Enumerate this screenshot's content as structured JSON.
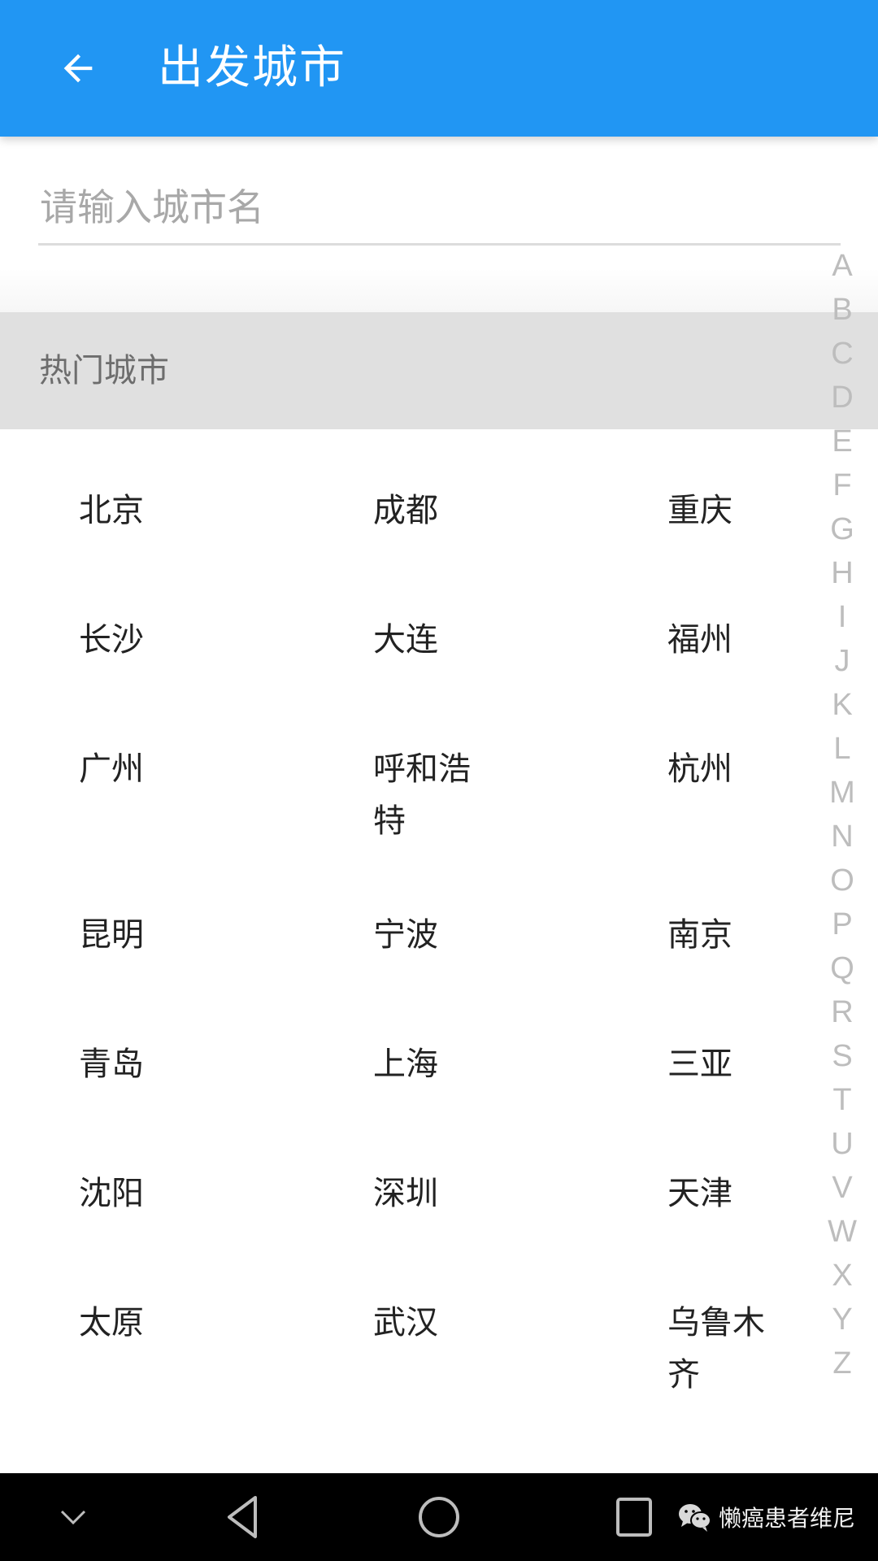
{
  "appbar": {
    "title": "出发城市",
    "back_icon": "arrow-left-icon",
    "background": "#2196f3"
  },
  "search": {
    "value": "",
    "placeholder": "请输入城市名"
  },
  "hot_section": {
    "title": "热门城市"
  },
  "cities": [
    [
      "北京",
      "成都",
      "重庆"
    ],
    [
      "长沙",
      "大连",
      "福州"
    ],
    [
      "广州",
      "呼和浩特",
      "杭州"
    ],
    [
      "昆明",
      "宁波",
      "南京"
    ],
    [
      "青岛",
      "上海",
      "三亚"
    ],
    [
      "沈阳",
      "深圳",
      "天津"
    ],
    [
      "太原",
      "武汉",
      "乌鲁木齐"
    ]
  ],
  "index_letters": [
    "A",
    "B",
    "C",
    "D",
    "E",
    "F",
    "G",
    "H",
    "I",
    "J",
    "K",
    "L",
    "M",
    "N",
    "O",
    "P",
    "Q",
    "R",
    "S",
    "T",
    "U",
    "V",
    "W",
    "X",
    "Y",
    "Z"
  ],
  "navbar": {
    "buttons": [
      "collapse-icon",
      "back-triangle-icon",
      "home-circle-icon",
      "recents-square-icon"
    ],
    "watermark": "懒癌患者维尼",
    "watermark_icon": "wechat-icon"
  }
}
